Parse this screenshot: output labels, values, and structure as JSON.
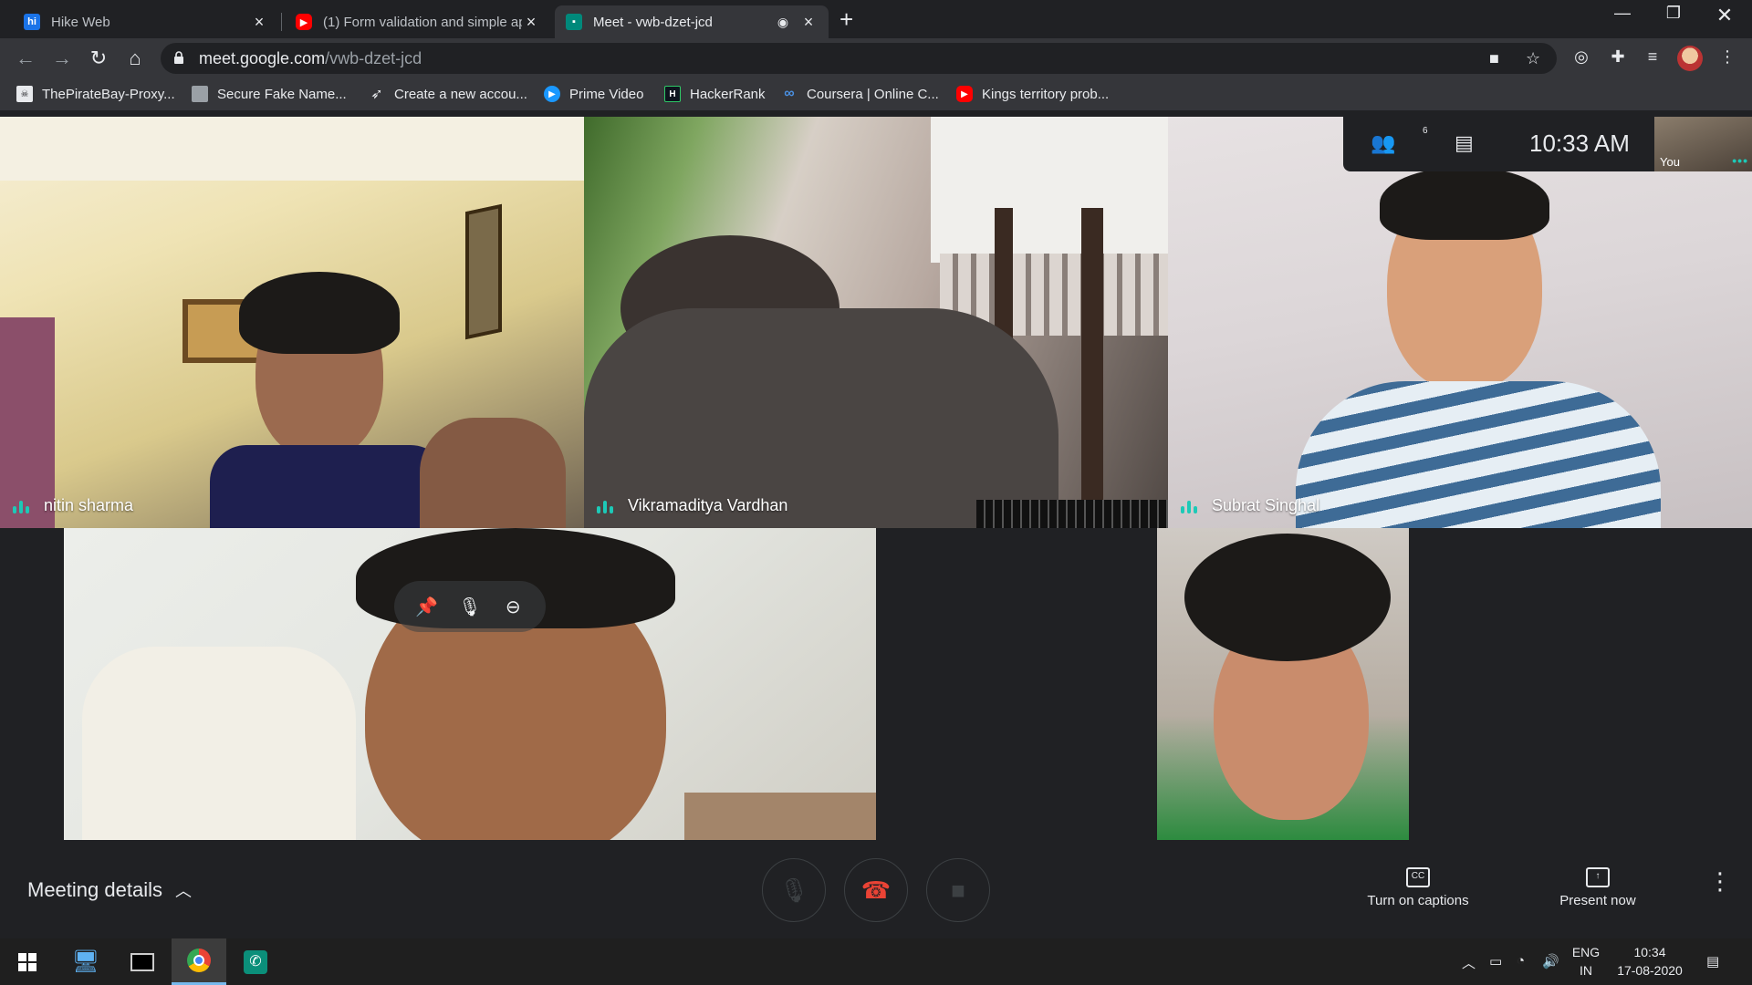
{
  "browser": {
    "tabs": [
      {
        "title": "Hike Web",
        "favicon": "hike-icon"
      },
      {
        "title": "(1) Form validation and simple ap",
        "favicon": "youtube-icon"
      },
      {
        "title": "Meet - vwb-dzet-jcd",
        "favicon": "meet-icon",
        "active": true
      }
    ],
    "url_domain": "meet.google.com",
    "url_path": "/vwb-dzet-jcd",
    "bookmarks": [
      {
        "label": "ThePirateBay-Proxy...",
        "icon": "pirate-icon"
      },
      {
        "label": "Secure Fake Name...",
        "icon": "page-icon"
      },
      {
        "label": "Create a new accou...",
        "icon": "send-icon"
      },
      {
        "label": "Prime Video",
        "icon": "prime-icon"
      },
      {
        "label": "HackerRank",
        "icon": "hackerrank-icon"
      },
      {
        "label": "Coursera | Online C...",
        "icon": "coursera-icon"
      },
      {
        "label": "Kings territory prob...",
        "icon": "youtube-icon"
      }
    ]
  },
  "meet": {
    "participants_count": "6",
    "time": "10:33  AM",
    "self_label": "You",
    "tiles": [
      {
        "name": "nitin sharma"
      },
      {
        "name": "Vikramaditya Vardhan"
      },
      {
        "name": "Subrat Singhal"
      }
    ],
    "meeting_details": "Meeting details",
    "captions_label": "Turn on captions",
    "present_label": "Present now"
  },
  "taskbar": {
    "language_top": "ENG",
    "language_bottom": "IN",
    "time": "10:34",
    "date": "17-08-2020"
  }
}
